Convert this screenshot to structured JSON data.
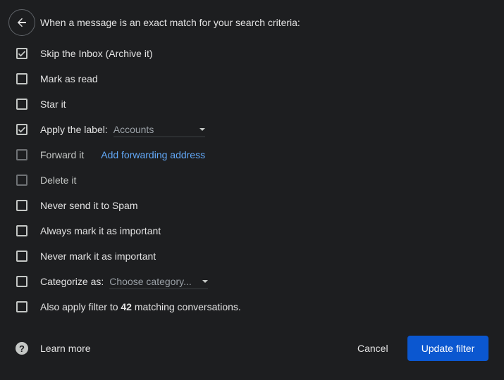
{
  "header": {
    "back_icon": "arrow-back-icon",
    "text": "When a message is an exact match for your search criteria:"
  },
  "options": {
    "skip_inbox": {
      "label": "Skip the Inbox (Archive it)",
      "checked": true
    },
    "mark_read": {
      "label": "Mark as read",
      "checked": false
    },
    "star": {
      "label": "Star it",
      "checked": false
    },
    "apply_label": {
      "label": "Apply the label:",
      "checked": true,
      "select_value": "Accounts"
    },
    "forward": {
      "label": "Forward it",
      "checked": false,
      "disabled": true,
      "link": "Add forwarding address"
    },
    "delete": {
      "label": "Delete it",
      "checked": false,
      "disabled": true
    },
    "never_spam": {
      "label": "Never send it to Spam",
      "checked": false
    },
    "always_important": {
      "label": "Always mark it as important",
      "checked": false
    },
    "never_important": {
      "label": "Never mark it as important",
      "checked": false
    },
    "categorize": {
      "label": "Categorize as:",
      "checked": false,
      "select_value": "Choose category..."
    },
    "also_apply": {
      "prefix": "Also apply filter to",
      "count": "42",
      "suffix": "matching conversations.",
      "checked": false
    }
  },
  "footer": {
    "help_icon": "help-icon",
    "learn_more": "Learn more",
    "cancel": "Cancel",
    "update": "Update filter"
  },
  "colors": {
    "background": "#1d1e20",
    "text": "#e3e3e3",
    "link": "#62a8f7",
    "primary_button": "#0b57d0"
  }
}
